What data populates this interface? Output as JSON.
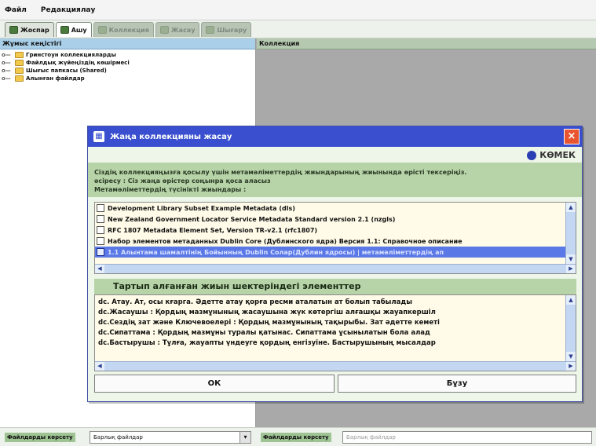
{
  "menubar": {
    "file": "Файл",
    "edit": "Редакциялау"
  },
  "toolbar": {
    "tabs": [
      {
        "label": "Жоспар"
      },
      {
        "label": "Ашу"
      },
      {
        "label": "Коллекция"
      },
      {
        "label": "Жасау"
      },
      {
        "label": "Шығару"
      }
    ]
  },
  "left_panel": {
    "title": "Жұмыс кеңістігі",
    "tree": [
      {
        "label": "Гринстоун коллекцияларды"
      },
      {
        "label": "Файлдық жүйеңіздің көшірмесі"
      },
      {
        "label": "Шығыс папкасы (Shared)"
      },
      {
        "label": "Алынған файлдар"
      }
    ]
  },
  "right_panel": {
    "title": "Коллекция"
  },
  "statusbar": {
    "left_label": "Файлдарды көрсету",
    "left_value": "Барлық файлдар",
    "right_label": "Файлдарды көрсету",
    "right_value": "Барлық файлдар"
  },
  "dialog": {
    "title": "Жаңа коллекцияны жасау",
    "close": "×",
    "help": "КӨМЕК",
    "instructions_line1": "Сіздің коллекцияңызға қосылу үшін метамәліметтердің жиындарының жиынында өрісті тексеріңіз.",
    "instructions_line2": "әсіресу : Сіз жаңа өрістер соңынра қоса аласыз",
    "instructions_line3": "Метамәліметтердің түсінікті жиындары :",
    "schemas": [
      {
        "label": "Development Library Subset Example Metadata (dls)",
        "checked": false
      },
      {
        "label": "New Zealand Government Locator Service Metadata Standard version 2.1 (nzgls)",
        "checked": false
      },
      {
        "label": "RFC 1807 Metadata Element Set, Version TR-v2.1 (rfc1807)",
        "checked": false
      },
      {
        "label": "Набор элементов метаданных Dublin Core (Дублинского ядра) Версия 1.1: Справочное описание",
        "checked": false
      },
      {
        "label": "1.1 Алынтама шамалтінің Бойынның Dublin Солар(Дублин ядросы) | метамәліметтердің ап",
        "checked": true
      }
    ],
    "elements_heading": "Тартып алғанған жиын шектеріндегі элементтер",
    "elements": [
      "dc. Атау. Ат, осы кғарга. Әдетте атау қорға ресми аталатын ат болып табылады",
      "dc.Жасаушы : Қордың мазмұнының жасаушына жүк көтергіш алғашқы жауапкершіл",
      "dc.Сездің зат және Ключевоелері : Қордың мазмұнының тақырыбы. Зат әдетте кеметі",
      "dc.Сипаттама : Қордың мазмұны туралы қатынас. Сипаттама ұсынылатын бола алад",
      "dc.Бастырушы : Тұлға, жауапты үндеуге қордың енгізуіне. Бастырушының мысалдар"
    ],
    "ok_label": "ОК",
    "cancel_label": "Бұзу"
  }
}
